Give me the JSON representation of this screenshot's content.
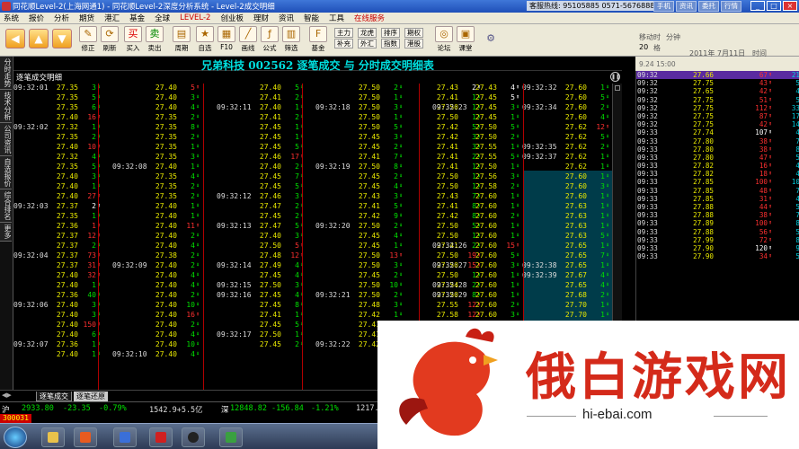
{
  "window": {
    "title": "同花顺Level-2(上海网通1) - 同花顺Level-2深度分析系统 - Level-2成交明细",
    "hotline": "客服热线: 95105885 0571-56768888",
    "title_buttons": [
      "手机",
      "资讯",
      "委托",
      "行情"
    ]
  },
  "menu": [
    "系统",
    "报价",
    "分析",
    "期货",
    "港汇",
    "基金",
    "全球",
    "LEVEL-2",
    "创业板",
    "理财",
    "资讯",
    "智能",
    "工具",
    "在线服务"
  ],
  "toolbar": {
    "buttons": [
      {
        "label": "修正",
        "icon": "pencil-icon"
      },
      {
        "label": "刷新",
        "icon": "refresh-icon"
      },
      {
        "label": "买入",
        "icon": "buy-icon"
      },
      {
        "label": "卖出",
        "icon": "sell-icon"
      },
      {
        "label": "周期",
        "icon": "period-icon"
      },
      {
        "label": "自选",
        "icon": "star-icon"
      },
      {
        "label": "F10",
        "icon": "f10-icon"
      },
      {
        "label": "画线",
        "icon": "draw-line-icon"
      },
      {
        "label": "公式",
        "icon": "formula-icon"
      },
      {
        "label": "筛选",
        "icon": "filter-icon"
      },
      {
        "label": "基金",
        "icon": "fund-icon"
      },
      {
        "label": "论坛",
        "icon": "forum-icon"
      },
      {
        "label": "课堂",
        "icon": "classroom-icon"
      }
    ],
    "small": [
      "主力",
      "龙虎",
      "排序",
      "期权",
      "补充",
      "外汇",
      "指数",
      "港股",
      "全球"
    ],
    "right": {
      "ma_label": "移动时",
      "period": "分钟",
      "count": "20",
      "unit": "格",
      "date_label": "2011年 7月11日",
      "time_label": "时间",
      "version": "9.24 15:00"
    }
  },
  "left_nav": [
    "分时走势",
    "技术分析",
    "公司资讯",
    "自选报价",
    "综合排名",
    "更多"
  ],
  "header": {
    "title": "兄弟科技 002562 逐笔成交 与 分时成交明细表",
    "sub_label": "逐笔成交明细"
  },
  "columns": [
    [
      [
        "09:32:01",
        "27.35",
        "3",
        "d"
      ],
      [
        "",
        "27.35",
        "5",
        "d"
      ],
      [
        "",
        "27.35",
        "6",
        "d"
      ],
      [
        "",
        "27.40",
        "16",
        "u"
      ],
      [
        "09:32:02",
        "27.32",
        "1",
        "d"
      ],
      [
        "",
        "27.35",
        "2",
        "d"
      ],
      [
        "",
        "27.40",
        "10",
        "u"
      ],
      [
        "",
        "27.32",
        "4",
        "d"
      ],
      [
        "",
        "27.35",
        "5",
        "d"
      ],
      [
        "",
        "27.40",
        "3",
        "d"
      ],
      [
        "",
        "27.40",
        "1",
        "d"
      ],
      [
        "",
        "27.40",
        "27",
        "u"
      ],
      [
        "09:32:03",
        "27.37",
        "2",
        "w"
      ],
      [
        "",
        "27.35",
        "1",
        "d"
      ],
      [
        "",
        "27.36",
        "1",
        "u"
      ],
      [
        "",
        "27.37",
        "12",
        "u"
      ],
      [
        "",
        "27.37",
        "2",
        "d"
      ],
      [
        "09:32:04",
        "27.37",
        "73",
        "u"
      ],
      [
        "",
        "27.37",
        "31",
        "u"
      ],
      [
        "",
        "27.40",
        "32",
        "u"
      ],
      [
        "",
        "27.40",
        "1",
        "d"
      ],
      [
        "",
        "27.36",
        "40",
        "d"
      ],
      [
        "09:32:06",
        "27.40",
        "3",
        "d"
      ],
      [
        "",
        "27.40",
        "3",
        "d"
      ],
      [
        "",
        "27.40",
        "150",
        "u"
      ],
      [
        "",
        "27.40",
        "6",
        "d"
      ],
      [
        "09:32:07",
        "27.36",
        "1",
        "d"
      ],
      [
        "",
        "27.40",
        "1",
        "d"
      ]
    ],
    [
      [
        "",
        "27.40",
        "5",
        "u"
      ],
      [
        "",
        "27.40",
        "3",
        "d"
      ],
      [
        "",
        "27.40",
        "4",
        "d"
      ],
      [
        "",
        "27.35",
        "2",
        "d"
      ],
      [
        "",
        "27.35",
        "8",
        "d"
      ],
      [
        "",
        "27.35",
        "2",
        "d"
      ],
      [
        "",
        "27.35",
        "1",
        "d"
      ],
      [
        "",
        "27.35",
        "3",
        "d"
      ],
      [
        "09:32:08",
        "27.40",
        "1",
        "d"
      ],
      [
        "",
        "27.35",
        "4",
        "d"
      ],
      [
        "",
        "27.35",
        "2",
        "d"
      ],
      [
        "",
        "27.35",
        "2",
        "d"
      ],
      [
        "",
        "27.40",
        "1",
        "d"
      ],
      [
        "",
        "27.40",
        "1",
        "d"
      ],
      [
        "",
        "27.40",
        "11",
        "u"
      ],
      [
        "",
        "27.40",
        "2",
        "d"
      ],
      [
        "",
        "27.40",
        "4",
        "d"
      ],
      [
        "",
        "27.38",
        "2",
        "d"
      ],
      [
        "09:32:09",
        "27.40",
        "2",
        "d"
      ],
      [
        "",
        "27.40",
        "4",
        "d"
      ],
      [
        "",
        "27.40",
        "4",
        "d"
      ],
      [
        "",
        "27.40",
        "2",
        "d"
      ],
      [
        "",
        "27.40",
        "10",
        "d"
      ],
      [
        "",
        "27.40",
        "16",
        "u"
      ],
      [
        "",
        "27.40",
        "2",
        "d"
      ],
      [
        "",
        "27.40",
        "4",
        "d"
      ],
      [
        "",
        "27.40",
        "10",
        "d"
      ],
      [
        "09:32:10",
        "27.40",
        "4",
        "d"
      ]
    ],
    [
      [
        "",
        "27.40",
        "5",
        "d"
      ],
      [
        "",
        "27.41",
        "2",
        "d"
      ],
      [
        "09:32:11",
        "27.40",
        "1",
        "d"
      ],
      [
        "",
        "27.41",
        "2",
        "d"
      ],
      [
        "",
        "27.45",
        "1",
        "d"
      ],
      [
        "",
        "27.45",
        "1",
        "d"
      ],
      [
        "",
        "27.45",
        "5",
        "d"
      ],
      [
        "",
        "27.46",
        "17",
        "u"
      ],
      [
        "",
        "27.40",
        "2",
        "d"
      ],
      [
        "",
        "27.45",
        "7",
        "d"
      ],
      [
        "",
        "27.45",
        "5",
        "d"
      ],
      [
        "09:32:12",
        "27.46",
        "3",
        "d"
      ],
      [
        "",
        "27.47",
        "2",
        "d"
      ],
      [
        "",
        "27.45",
        "2",
        "d"
      ],
      [
        "09:32:13",
        "27.47",
        "5",
        "d"
      ],
      [
        "",
        "27.40",
        "3",
        "d"
      ],
      [
        "",
        "27.50",
        "5",
        "u"
      ],
      [
        "",
        "27.48",
        "12",
        "u"
      ],
      [
        "09:32:14",
        "27.49",
        "4",
        "d"
      ],
      [
        "",
        "27.45",
        "4",
        "d"
      ],
      [
        "09:32:15",
        "27.50",
        "3",
        "d"
      ],
      [
        "09:32:16",
        "27.45",
        "4",
        "d"
      ],
      [
        "",
        "27.45",
        "8",
        "d"
      ],
      [
        "",
        "27.41",
        "1",
        "d"
      ],
      [
        "",
        "27.45",
        "5",
        "d"
      ],
      [
        "09:32:17",
        "27.50",
        "1",
        "d"
      ],
      [
        "",
        "27.45",
        "2",
        "d"
      ]
    ],
    [
      [
        "",
        "27.50",
        "2",
        "d"
      ],
      [
        "",
        "27.50",
        "1",
        "d"
      ],
      [
        "09:32:18",
        "27.50",
        "3",
        "d"
      ],
      [
        "",
        "27.50",
        "1",
        "d"
      ],
      [
        "",
        "27.50",
        "5",
        "d"
      ],
      [
        "",
        "27.45",
        "3",
        "d"
      ],
      [
        "",
        "27.45",
        "2",
        "d"
      ],
      [
        "",
        "27.41",
        "7",
        "d"
      ],
      [
        "09:32:19",
        "27.50",
        "8",
        "d"
      ],
      [
        "",
        "27.45",
        "2",
        "d"
      ],
      [
        "",
        "27.45",
        "4",
        "d"
      ],
      [
        "",
        "27.43",
        "3",
        "d"
      ],
      [
        "",
        "27.41",
        "5",
        "d"
      ],
      [
        "",
        "27.42",
        "9",
        "d"
      ],
      [
        "09:32:20",
        "27.50",
        "2",
        "d"
      ],
      [
        "",
        "27.45",
        "4",
        "d"
      ],
      [
        "",
        "27.45",
        "1",
        "d"
      ],
      [
        "",
        "27.50",
        "13",
        "u"
      ],
      [
        "",
        "27.50",
        "3",
        "d"
      ],
      [
        "",
        "27.45",
        "2",
        "d"
      ],
      [
        "",
        "27.50",
        "10",
        "d"
      ],
      [
        "09:32:21",
        "27.50",
        "2",
        "d"
      ],
      [
        "",
        "27.48",
        "3",
        "d"
      ],
      [
        "",
        "27.42",
        "1",
        "d"
      ],
      [
        "",
        "27.41",
        "2",
        "d"
      ],
      [
        "",
        "27.41",
        "2",
        "d"
      ],
      [
        "09:32:22",
        "27.42",
        "1",
        "d"
      ]
    ],
    [
      [
        "",
        "27.43",
        "2",
        "w"
      ],
      [
        "",
        "27.41",
        "1",
        "d"
      ],
      [
        "",
        "27.50",
        "1",
        "d"
      ],
      [
        "",
        "27.50",
        "1",
        "d"
      ],
      [
        "",
        "27.42",
        "5",
        "d"
      ],
      [
        "",
        "27.42",
        "3",
        "d"
      ],
      [
        "",
        "27.41",
        "3",
        "d"
      ],
      [
        "",
        "27.41",
        "2",
        "d"
      ],
      [
        "",
        "27.41",
        "1",
        "d"
      ],
      [
        "",
        "27.50",
        "1",
        "d"
      ],
      [
        "",
        "27.50",
        "1",
        "d"
      ],
      [
        "",
        "27.43",
        "7",
        "d"
      ],
      [
        "",
        "27.41",
        "8",
        "d"
      ],
      [
        "",
        "27.42",
        "8",
        "d"
      ],
      [
        "",
        "27.50",
        "5",
        "d"
      ],
      [
        "",
        "27.50",
        "1",
        "d"
      ],
      [
        "",
        "27.41",
        "2",
        "d"
      ],
      [
        "",
        "27.50",
        "19",
        "u"
      ],
      [
        "",
        "27.50",
        "15",
        "u"
      ],
      [
        "",
        "27.50",
        "1",
        "d"
      ],
      [
        "",
        "27.54",
        "2",
        "d"
      ],
      [
        "",
        "27.50",
        "8",
        "d"
      ],
      [
        "",
        "27.55",
        "12",
        "u"
      ],
      [
        "",
        "27.58",
        "12",
        "u"
      ],
      [
        "",
        "27.60",
        "6",
        "d"
      ],
      [
        "",
        "27.60",
        "6",
        "d"
      ],
      [
        "",
        "27.60",
        "2",
        "w"
      ]
    ],
    [
      [
        "",
        "27.43",
        "4",
        "w"
      ],
      [
        "",
        "27.45",
        "5",
        "w"
      ],
      [
        "09:32:23",
        "27.45",
        "3",
        "d"
      ],
      [
        "",
        "27.45",
        "1",
        "d"
      ],
      [
        "",
        "27.50",
        "5",
        "d"
      ],
      [
        "",
        "27.50",
        "2",
        "d"
      ],
      [
        "",
        "27.55",
        "1",
        "d"
      ],
      [
        "",
        "27.55",
        "5",
        "d"
      ],
      [
        "",
        "27.50",
        "1",
        "d"
      ],
      [
        "",
        "27.56",
        "3",
        "d"
      ],
      [
        "",
        "27.58",
        "2",
        "d"
      ],
      [
        "",
        "27.60",
        "1",
        "d"
      ],
      [
        "",
        "27.60",
        "1",
        "d"
      ],
      [
        "",
        "27.60",
        "2",
        "d"
      ],
      [
        "",
        "27.60",
        "1",
        "d"
      ],
      [
        "",
        "27.60",
        "1",
        "d"
      ],
      [
        "09:32:26",
        "27.60",
        "15",
        "u"
      ],
      [
        "",
        "27.60",
        "5",
        "d"
      ],
      [
        "09:32:27",
        "27.60",
        "3",
        "d"
      ],
      [
        "",
        "27.60",
        "1",
        "d"
      ],
      [
        "09:32:28",
        "27.60",
        "1",
        "d"
      ],
      [
        "09:32:29",
        "27.60",
        "1",
        "d"
      ],
      [
        "",
        "27.60",
        "2",
        "d"
      ],
      [
        "",
        "27.60",
        "3",
        "d"
      ],
      [
        "",
        "27.60",
        "1",
        "d"
      ],
      [
        "",
        "27.60",
        "3",
        "d"
      ],
      [
        "",
        "27.60",
        "2",
        "d"
      ]
    ],
    [
      [
        "09:32:32",
        "27.60",
        "1",
        "d"
      ],
      [
        "",
        "27.60",
        "5",
        "d"
      ],
      [
        "09:32:34",
        "27.60",
        "2",
        "d"
      ],
      [
        "",
        "27.60",
        "4",
        "d"
      ],
      [
        "",
        "27.62",
        "12",
        "u"
      ],
      [
        "",
        "27.62",
        "5",
        "d"
      ],
      [
        "09:32:35",
        "27.62",
        "2",
        "d"
      ],
      [
        "09:32:37",
        "27.62",
        "1",
        "d"
      ],
      [
        "",
        "27.62",
        "1",
        "d"
      ],
      [
        "",
        "27.60",
        "1",
        "d"
      ],
      [
        "",
        "27.60",
        "3",
        "d"
      ],
      [
        "",
        "27.60",
        "1",
        "d"
      ],
      [
        "",
        "27.63",
        "1",
        "d"
      ],
      [
        "",
        "27.63",
        "1",
        "d"
      ],
      [
        "",
        "27.63",
        "1",
        "d"
      ],
      [
        "",
        "27.63",
        "5",
        "d"
      ],
      [
        "",
        "27.65",
        "1",
        "d"
      ],
      [
        "",
        "27.65",
        "7",
        "d"
      ],
      [
        "09:32:38",
        "27.65",
        "1",
        "d"
      ],
      [
        "09:32:39",
        "27.67",
        "4",
        "d"
      ],
      [
        "",
        "27.65",
        "4",
        "d"
      ],
      [
        "",
        "27.68",
        "2",
        "d"
      ],
      [
        "",
        "27.70",
        "1",
        "d"
      ],
      [
        "",
        "27.70",
        "1",
        "d"
      ],
      [
        "",
        "27.70",
        "1",
        "d"
      ],
      [
        "",
        "27.70",
        "1",
        "d"
      ],
      [
        "",
        "27.70",
        "1",
        "d"
      ]
    ]
  ],
  "right_panel": [
    [
      "09:32",
      "27.66",
      "67",
      "u",
      "21"
    ],
    [
      "09:32",
      "27.75",
      "43",
      "u",
      "5"
    ],
    [
      "09:32",
      "27.65",
      "42",
      "u",
      "4"
    ],
    [
      "09:32",
      "27.75",
      "51",
      "u",
      "5"
    ],
    [
      "09:32",
      "27.75",
      "112",
      "u",
      "33"
    ],
    [
      "09:32",
      "27.75",
      "87",
      "u",
      "17"
    ],
    [
      "09:32",
      "27.75",
      "42",
      "u",
      "14"
    ],
    [
      "09:33",
      "27.74",
      "107",
      "w",
      "4"
    ],
    [
      "09:33",
      "27.80",
      "38",
      "u",
      "7"
    ],
    [
      "09:33",
      "27.80",
      "38",
      "u",
      "8"
    ],
    [
      "09:33",
      "27.80",
      "47",
      "u",
      "5"
    ],
    [
      "09:33",
      "27.82",
      "16",
      "u",
      "4"
    ],
    [
      "09:33",
      "27.82",
      "18",
      "u",
      "4"
    ],
    [
      "09:33",
      "27.85",
      "100",
      "u",
      "10"
    ],
    [
      "09:33",
      "27.85",
      "48",
      "u",
      "7"
    ],
    [
      "09:33",
      "27.85",
      "31",
      "u",
      "4"
    ],
    [
      "09:33",
      "27.88",
      "44",
      "u",
      "5"
    ],
    [
      "09:33",
      "27.88",
      "38",
      "u",
      "7"
    ],
    [
      "09:33",
      "27.89",
      "100",
      "u",
      "8"
    ],
    [
      "09:33",
      "27.88",
      "56",
      "u",
      "5"
    ],
    [
      "09:33",
      "27.99",
      "72",
      "u",
      "8"
    ],
    [
      "09:33",
      "27.90",
      "120",
      "w",
      "9"
    ],
    [
      "09:33",
      "27.90",
      "34",
      "u",
      "5"
    ]
  ],
  "tabs": [
    "逐笔成交",
    "逐笔还原"
  ],
  "status": {
    "sh_label": "沪",
    "sh_index": "2933.80",
    "sh_change": "-23.35",
    "sh_pct": "-0.79%",
    "sh_amount": "1542.9+5.5亿",
    "sz_label": "深",
    "sz_index": "12848.82",
    "sz_change": "-156.84",
    "sz_pct": "-1.21%",
    "sz_amount": "1217."
  },
  "input_code": "300031",
  "watermark": {
    "text": "俄白游戏网",
    "url": "hi-ebai.com"
  },
  "colors": {
    "price": "#e8e800",
    "up": "#ff3030",
    "down": "#00e000",
    "title": "#00e0e0",
    "highlight": "#003c4a"
  }
}
